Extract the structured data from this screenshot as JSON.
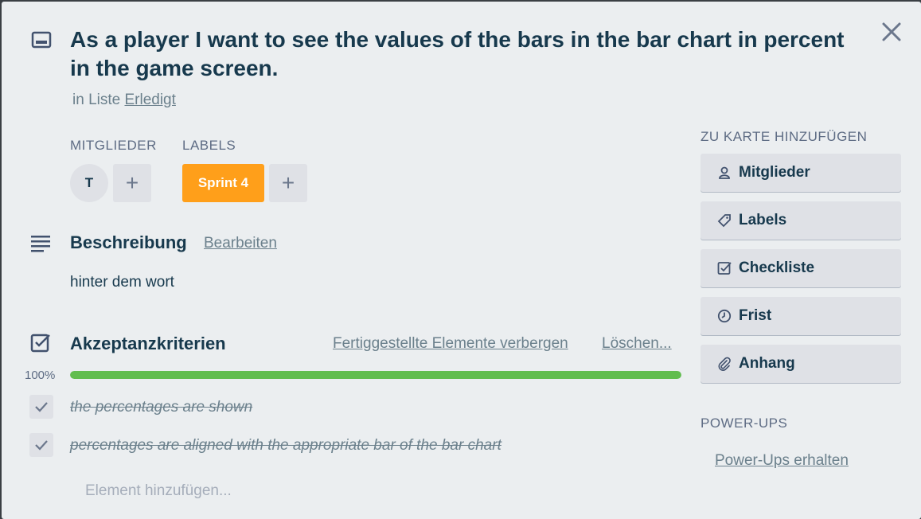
{
  "card": {
    "title": "As a player I want to see the values of the bars in the bar chart in percent in the game screen.",
    "list_prefix": "in Liste",
    "list_name": "Erledigt"
  },
  "members": {
    "heading": "MITGLIEDER",
    "avatar_initial": "T",
    "add_symbol": "+"
  },
  "labels": {
    "heading": "LABELS",
    "items": [
      {
        "text": "Sprint 4",
        "color": "#ff9f1a"
      }
    ],
    "add_symbol": "+"
  },
  "description": {
    "heading": "Beschreibung",
    "edit_label": "Bearbeiten",
    "text": "hinter dem wort"
  },
  "checklist": {
    "title": "Akzeptanzkriterien",
    "hide_completed_label": "Fertiggestellte Elemente verbergen",
    "delete_label": "Löschen...",
    "progress_text": "100%",
    "progress_fraction": 1.0,
    "progress_color": "#61bd4f",
    "items": [
      {
        "text": "the percentages are shown",
        "checked": true
      },
      {
        "text": "percentages are aligned with the appropriate bar of the bar chart",
        "checked": true
      }
    ],
    "add_item_placeholder": "Element hinzufügen..."
  },
  "sidebar": {
    "add_heading": "ZU KARTE HINZUFÜGEN",
    "buttons": [
      {
        "label": "Mitglieder",
        "icon": "person-icon"
      },
      {
        "label": "Labels",
        "icon": "tag-icon"
      },
      {
        "label": "Checkliste",
        "icon": "checklist-icon"
      },
      {
        "label": "Frist",
        "icon": "clock-icon"
      },
      {
        "label": "Anhang",
        "icon": "paperclip-icon"
      }
    ],
    "powerups_heading": "POWER-UPS",
    "powerups_link": "Power-Ups erhalten"
  },
  "icons": {
    "card": "card-icon",
    "description": "description-lines-icon",
    "checklist": "checklist-icon",
    "close": "close-icon"
  }
}
